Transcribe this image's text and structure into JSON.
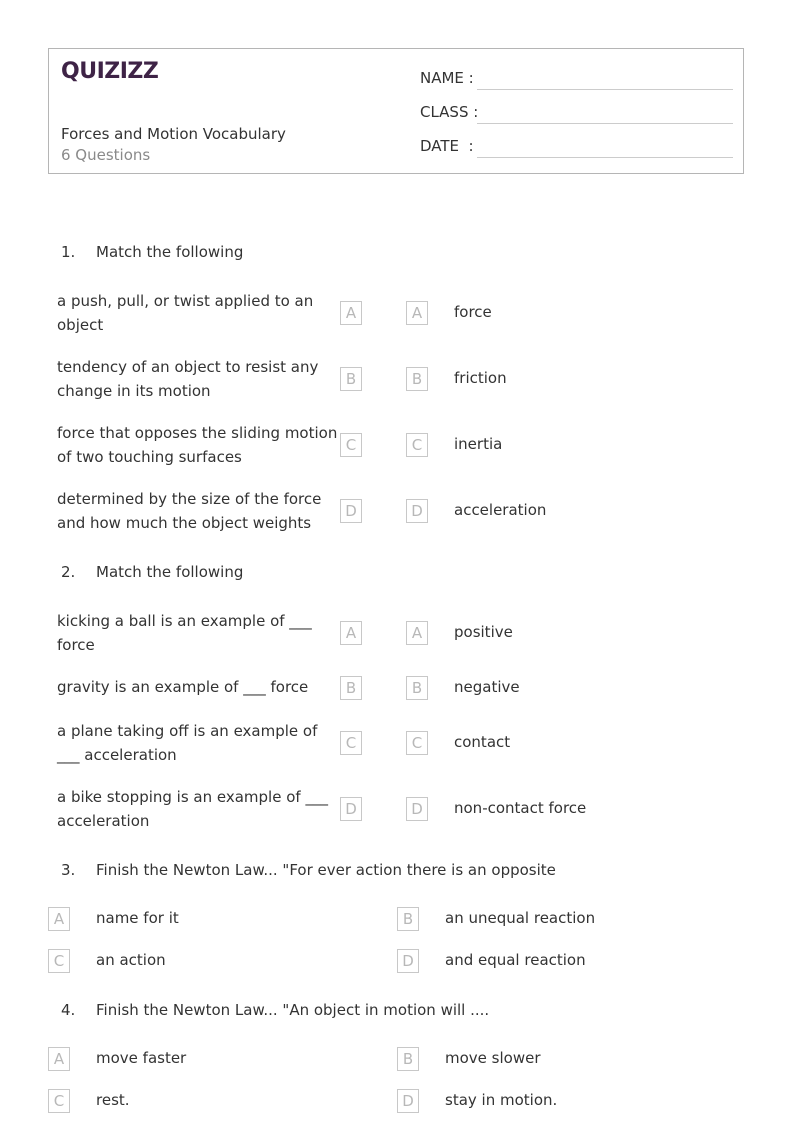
{
  "header": {
    "logo_text": "QUIZIZZ",
    "title": "Forces and Motion Vocabulary",
    "subtitle": "6 Questions",
    "fields": [
      {
        "label": "NAME :"
      },
      {
        "label": "CLASS :"
      },
      {
        "label": "DATE  :"
      }
    ]
  },
  "questions": [
    {
      "number": "1.",
      "prompt": "Match the following",
      "type": "match",
      "left": [
        {
          "text": "a push, pull, or twist applied to an object",
          "letter": "A"
        },
        {
          "text": "tendency of an object to resist any change in its motion",
          "letter": "B"
        },
        {
          "text": "force that opposes the sliding motion of two touching surfaces",
          "letter": "C"
        },
        {
          "text": "determined by the size of the force and how much the object weights",
          "letter": "D"
        }
      ],
      "right": [
        {
          "letter": "A",
          "text": "force"
        },
        {
          "letter": "B",
          "text": "friction"
        },
        {
          "letter": "C",
          "text": "inertia"
        },
        {
          "letter": "D",
          "text": "acceleration"
        }
      ]
    },
    {
      "number": "2.",
      "prompt": "Match the following",
      "type": "match",
      "left": [
        {
          "text": "kicking a ball is an example of ___ force",
          "letter": "A"
        },
        {
          "text": "gravity is an example of ___ force",
          "letter": "B"
        },
        {
          "text": "a plane taking off is an example of ___ acceleration",
          "letter": "C"
        },
        {
          "text": "a bike stopping is an example of ___ acceleration",
          "letter": "D"
        }
      ],
      "right": [
        {
          "letter": "A",
          "text": "positive"
        },
        {
          "letter": "B",
          "text": "negative"
        },
        {
          "letter": "C",
          "text": "contact"
        },
        {
          "letter": "D",
          "text": "non-contact force"
        }
      ]
    },
    {
      "number": "3.",
      "prompt": "Finish the Newton Law... \"For ever action there is an opposite",
      "type": "multiple-choice",
      "options": [
        {
          "letter": "A",
          "text": "name for it"
        },
        {
          "letter": "B",
          "text": "an unequal reaction"
        },
        {
          "letter": "C",
          "text": "an action"
        },
        {
          "letter": "D",
          "text": "and equal reaction"
        }
      ]
    },
    {
      "number": "4.",
      "prompt": "Finish the Newton Law... \"An object in motion will ....",
      "type": "multiple-choice",
      "options": [
        {
          "letter": "A",
          "text": "move faster"
        },
        {
          "letter": "B",
          "text": "move slower"
        },
        {
          "letter": "C",
          "text": "rest."
        },
        {
          "letter": "D",
          "text": "stay in motion."
        }
      ]
    }
  ]
}
